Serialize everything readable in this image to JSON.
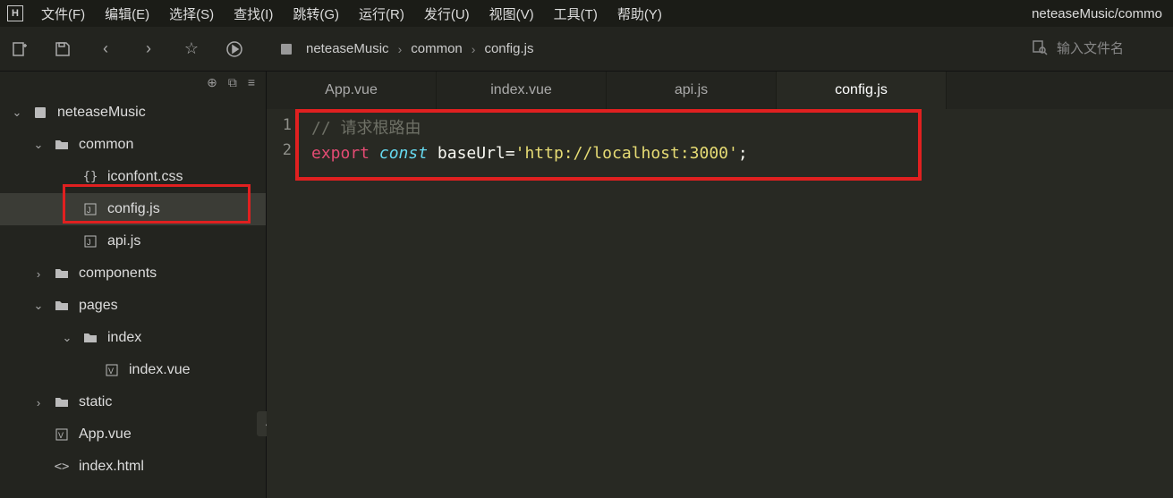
{
  "menubar": {
    "logo": "H",
    "items": [
      "文件(F)",
      "编辑(E)",
      "选择(S)",
      "查找(I)",
      "跳转(G)",
      "运行(R)",
      "发行(U)",
      "视图(V)",
      "工具(T)",
      "帮助(Y)"
    ],
    "title_right": "neteaseMusic/commo"
  },
  "toolbar": {
    "breadcrumb": [
      "neteaseMusic",
      "common",
      "config.js"
    ],
    "search_placeholder": "输入文件名"
  },
  "tree": [
    {
      "depth": 0,
      "expand": "down",
      "icon": "project",
      "label": "neteaseMusic"
    },
    {
      "depth": 1,
      "expand": "down",
      "icon": "folder",
      "label": "common"
    },
    {
      "depth": 2,
      "expand": "",
      "icon": "css",
      "label": "iconfont.css"
    },
    {
      "depth": 2,
      "expand": "",
      "icon": "js",
      "label": "config.js",
      "active": true,
      "highlighted": true
    },
    {
      "depth": 2,
      "expand": "",
      "icon": "js",
      "label": "api.js"
    },
    {
      "depth": 1,
      "expand": "right",
      "icon": "folder",
      "label": "components"
    },
    {
      "depth": 1,
      "expand": "down",
      "icon": "folder",
      "label": "pages"
    },
    {
      "depth": 2,
      "expand": "down",
      "icon": "folder",
      "label": "index"
    },
    {
      "depth": 3,
      "expand": "",
      "icon": "vue",
      "label": "index.vue"
    },
    {
      "depth": 1,
      "expand": "right",
      "icon": "folder",
      "label": "static"
    },
    {
      "depth": 1,
      "expand": "",
      "icon": "vue",
      "label": "App.vue"
    },
    {
      "depth": 1,
      "expand": "",
      "icon": "html",
      "label": "index.html"
    }
  ],
  "tabs": [
    {
      "label": "App.vue",
      "active": false
    },
    {
      "label": "index.vue",
      "active": false
    },
    {
      "label": "api.js",
      "active": false
    },
    {
      "label": "config.js",
      "active": true
    }
  ],
  "editor": {
    "lines": [
      {
        "num": "1",
        "tokens": [
          {
            "cls": "comment",
            "t": "// 请求根路由"
          }
        ]
      },
      {
        "num": "2",
        "tokens": [
          {
            "cls": "kw-export",
            "t": "export"
          },
          {
            "cls": "",
            "t": " "
          },
          {
            "cls": "kw-const",
            "t": "const"
          },
          {
            "cls": "",
            "t": " "
          },
          {
            "cls": "ident",
            "t": "baseUrl"
          },
          {
            "cls": "punct",
            "t": "="
          },
          {
            "cls": "string",
            "t": "'http://localhost:3000'"
          },
          {
            "cls": "punct",
            "t": ";"
          }
        ]
      }
    ]
  }
}
